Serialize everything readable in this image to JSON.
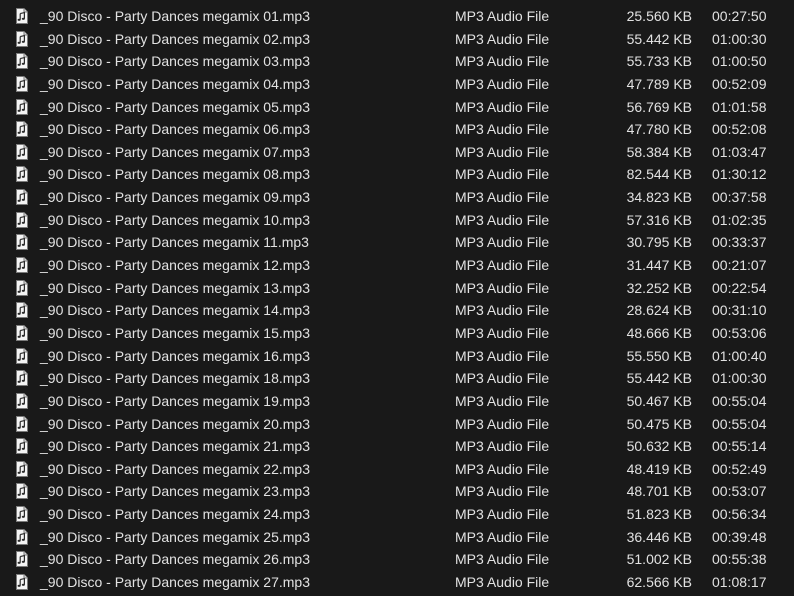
{
  "icon": "mp3-file-icon",
  "files": [
    {
      "name": "_90 Disco - Party Dances megamix 01.mp3",
      "type": "MP3 Audio File",
      "size": "25.560 KB",
      "duration": "00:27:50"
    },
    {
      "name": "_90 Disco - Party Dances megamix 02.mp3",
      "type": "MP3 Audio File",
      "size": "55.442 KB",
      "duration": "01:00:30"
    },
    {
      "name": "_90 Disco - Party Dances megamix 03.mp3",
      "type": "MP3 Audio File",
      "size": "55.733 KB",
      "duration": "01:00:50"
    },
    {
      "name": "_90 Disco - Party Dances megamix 04.mp3",
      "type": "MP3 Audio File",
      "size": "47.789 KB",
      "duration": "00:52:09"
    },
    {
      "name": "_90 Disco - Party Dances megamix 05.mp3",
      "type": "MP3 Audio File",
      "size": "56.769 KB",
      "duration": "01:01:58"
    },
    {
      "name": "_90 Disco - Party Dances megamix 06.mp3",
      "type": "MP3 Audio File",
      "size": "47.780 KB",
      "duration": "00:52:08"
    },
    {
      "name": "_90 Disco - Party Dances megamix 07.mp3",
      "type": "MP3 Audio File",
      "size": "58.384 KB",
      "duration": "01:03:47"
    },
    {
      "name": "_90 Disco - Party Dances megamix 08.mp3",
      "type": "MP3 Audio File",
      "size": "82.544 KB",
      "duration": "01:30:12"
    },
    {
      "name": "_90 Disco - Party Dances megamix 09.mp3",
      "type": "MP3 Audio File",
      "size": "34.823 KB",
      "duration": "00:37:58"
    },
    {
      "name": "_90 Disco - Party Dances megamix 10.mp3",
      "type": "MP3 Audio File",
      "size": "57.316 KB",
      "duration": "01:02:35"
    },
    {
      "name": "_90 Disco - Party Dances megamix 11.mp3",
      "type": "MP3 Audio File",
      "size": "30.795 KB",
      "duration": "00:33:37"
    },
    {
      "name": "_90 Disco - Party Dances megamix 12.mp3",
      "type": "MP3 Audio File",
      "size": "31.447 KB",
      "duration": "00:21:07"
    },
    {
      "name": "_90 Disco - Party Dances megamix 13.mp3",
      "type": "MP3 Audio File",
      "size": "32.252 KB",
      "duration": "00:22:54"
    },
    {
      "name": "_90 Disco - Party Dances megamix 14.mp3",
      "type": "MP3 Audio File",
      "size": "28.624 KB",
      "duration": "00:31:10"
    },
    {
      "name": "_90 Disco - Party Dances megamix 15.mp3",
      "type": "MP3 Audio File",
      "size": "48.666 KB",
      "duration": "00:53:06"
    },
    {
      "name": "_90 Disco - Party Dances megamix 16.mp3",
      "type": "MP3 Audio File",
      "size": "55.550 KB",
      "duration": "01:00:40"
    },
    {
      "name": "_90 Disco - Party Dances megamix 18.mp3",
      "type": "MP3 Audio File",
      "size": "55.442 KB",
      "duration": "01:00:30"
    },
    {
      "name": "_90 Disco - Party Dances megamix 19.mp3",
      "type": "MP3 Audio File",
      "size": "50.467 KB",
      "duration": "00:55:04"
    },
    {
      "name": "_90 Disco - Party Dances megamix 20.mp3",
      "type": "MP3 Audio File",
      "size": "50.475 KB",
      "duration": "00:55:04"
    },
    {
      "name": "_90 Disco - Party Dances megamix 21.mp3",
      "type": "MP3 Audio File",
      "size": "50.632 KB",
      "duration": "00:55:14"
    },
    {
      "name": "_90 Disco - Party Dances megamix 22.mp3",
      "type": "MP3 Audio File",
      "size": "48.419 KB",
      "duration": "00:52:49"
    },
    {
      "name": "_90 Disco - Party Dances megamix 23.mp3",
      "type": "MP3 Audio File",
      "size": "48.701 KB",
      "duration": "00:53:07"
    },
    {
      "name": "_90 Disco - Party Dances megamix 24.mp3",
      "type": "MP3 Audio File",
      "size": "51.823 KB",
      "duration": "00:56:34"
    },
    {
      "name": "_90 Disco - Party Dances megamix 25.mp3",
      "type": "MP3 Audio File",
      "size": "36.446 KB",
      "duration": "00:39:48"
    },
    {
      "name": "_90 Disco - Party Dances megamix 26.mp3",
      "type": "MP3 Audio File",
      "size": "51.002 KB",
      "duration": "00:55:38"
    },
    {
      "name": "_90 Disco - Party Dances megamix 27.mp3",
      "type": "MP3 Audio File",
      "size": "62.566 KB",
      "duration": "01:08:17"
    }
  ]
}
